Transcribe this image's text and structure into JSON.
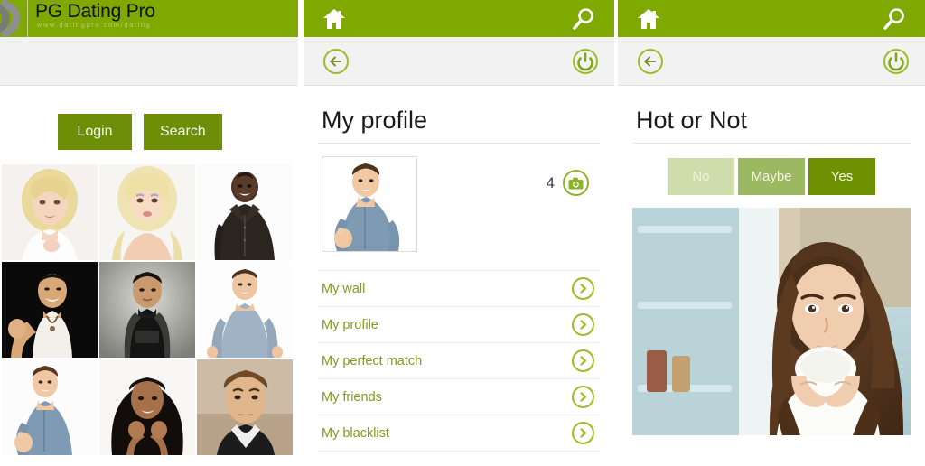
{
  "app": {
    "logo_title": "PG Dating Pro",
    "logo_subtitle": "www.datingpro.com/dating",
    "brand_green": "#7fa800",
    "button_green": "#6d8f07",
    "accent_green": "#84991f"
  },
  "panel1": {
    "toolbar": {
      "logo_icon": "swirl-logo-icon"
    },
    "buttons": {
      "login_label": "Login",
      "search_label": "Search"
    },
    "gallery": {
      "items": [
        {
          "alt": "blonde-woman-white-top"
        },
        {
          "alt": "blonde-woman-portrait"
        },
        {
          "alt": "black-man-black-shirt"
        },
        {
          "alt": "asian-man-white-tank"
        },
        {
          "alt": "man-black-turtleneck"
        },
        {
          "alt": "man-blue-tshirt"
        },
        {
          "alt": "young-man-blue-shirt"
        },
        {
          "alt": "woman-dark-hair-hands-on-face"
        },
        {
          "alt": "man-stubble-portrait"
        }
      ]
    }
  },
  "panel2": {
    "toolbar": {
      "home_icon": "home-icon",
      "search_icon": "search-icon",
      "back_icon": "back-arrow-icon",
      "power_icon": "power-icon"
    },
    "heading": "My profile",
    "avatar_alt": "profile-photo-man-blue-shirt",
    "photo_count": "4",
    "camera_icon": "camera-icon",
    "menu": [
      {
        "label": "My wall"
      },
      {
        "label": "My profile"
      },
      {
        "label": "My perfect match"
      },
      {
        "label": "My friends"
      },
      {
        "label": "My blacklist"
      }
    ]
  },
  "panel3": {
    "toolbar": {
      "home_icon": "home-icon",
      "search_icon": "search-icon",
      "back_icon": "back-arrow-icon",
      "power_icon": "power-icon"
    },
    "heading": "Hot or Not",
    "vote_buttons": [
      {
        "label": "No",
        "color": "#cfdcab"
      },
      {
        "label": "Maybe",
        "color": "#9cb860"
      },
      {
        "label": "Yes",
        "color": "#6d9100"
      }
    ],
    "photo_alt": "woman-holding-white-mug-kitchen"
  }
}
